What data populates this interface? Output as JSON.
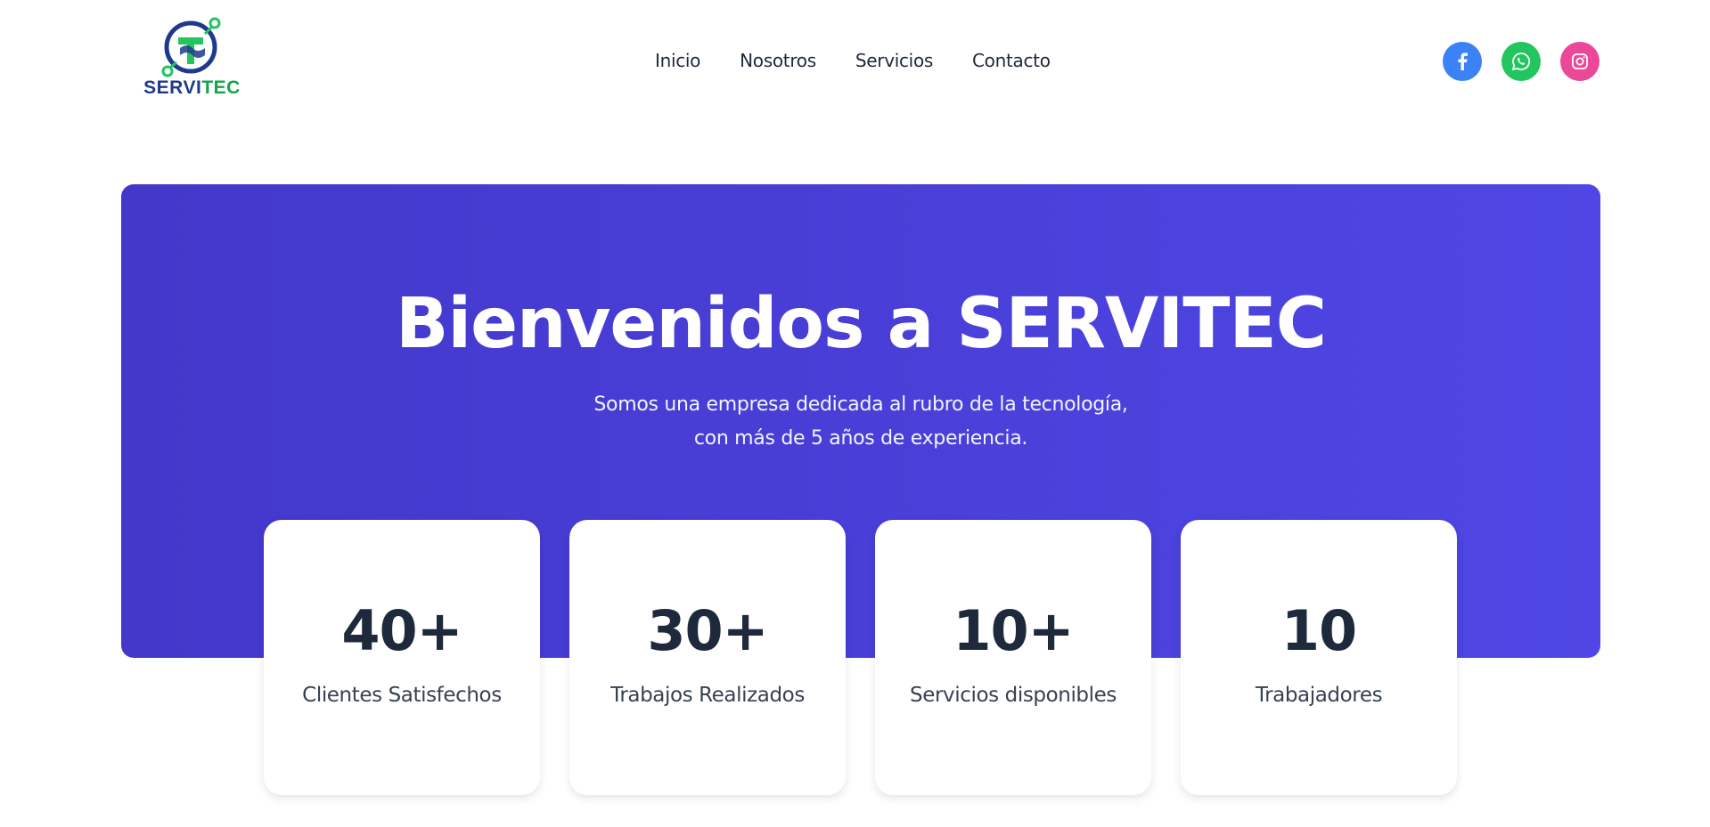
{
  "brand": {
    "name_part1": "SERVI",
    "name_part2": "TEC",
    "colors": {
      "primary": "#1e3a8a",
      "accent": "#16a34a"
    }
  },
  "nav": {
    "items": [
      "Inicio",
      "Nosotros",
      "Servicios",
      "Contacto"
    ]
  },
  "social": [
    {
      "icon": "facebook-icon",
      "color": "#3b82f6"
    },
    {
      "icon": "whatsapp-icon",
      "color": "#22c55e"
    },
    {
      "icon": "instagram-icon",
      "color": "#ec4899"
    }
  ],
  "hero": {
    "title": "Bienvenidos a SERVITEC",
    "subtitle_line1": "Somos una empresa dedicada al rubro de la tecnología,",
    "subtitle_line2": "con más de 5 años de experiencia.",
    "gradient": [
      "#4338ca",
      "#4f46e5"
    ]
  },
  "stats": [
    {
      "value": "40+",
      "label": "Clientes Satisfechos"
    },
    {
      "value": "30+",
      "label": "Trabajos Realizados"
    },
    {
      "value": "10+",
      "label": "Servicios disponibles"
    },
    {
      "value": "10",
      "label": "Trabajadores"
    }
  ]
}
